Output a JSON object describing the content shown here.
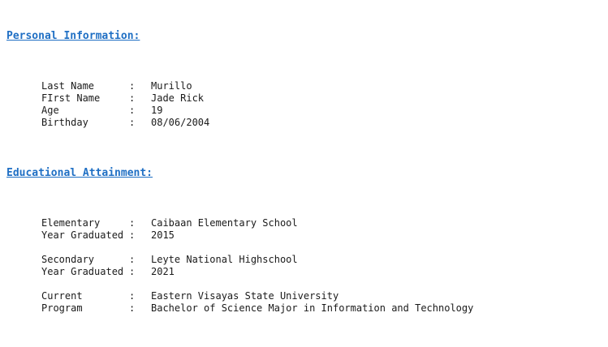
{
  "personal": {
    "heading": "Personal Information:",
    "rows": [
      {
        "label": "Last Name",
        "value": "Murillo"
      },
      {
        "label": "FIrst Name",
        "value": "Jade Rick"
      },
      {
        "label": "Age",
        "value": "19"
      },
      {
        "label": "Birthday",
        "value": "08/06/2004"
      }
    ]
  },
  "education": {
    "heading": "Educational Attainment:",
    "elementary": [
      {
        "label": "Elementary",
        "value": "Caibaan Elementary School"
      },
      {
        "label": "Year Graduated",
        "value": "2015"
      }
    ],
    "secondary": [
      {
        "label": "Secondary",
        "value": "Leyte National Highschool"
      },
      {
        "label": "Year Graduated",
        "value": "2021"
      }
    ],
    "current": [
      {
        "label": "Current",
        "value": "Eastern Visayas State University"
      },
      {
        "label": "Program",
        "value": "Bachelor of Science Major in Information and Technology"
      }
    ]
  },
  "separator": ":",
  "colors": {
    "heading": "#1f6fc4",
    "text": "#1a1a1a",
    "background": "#ffffff"
  }
}
